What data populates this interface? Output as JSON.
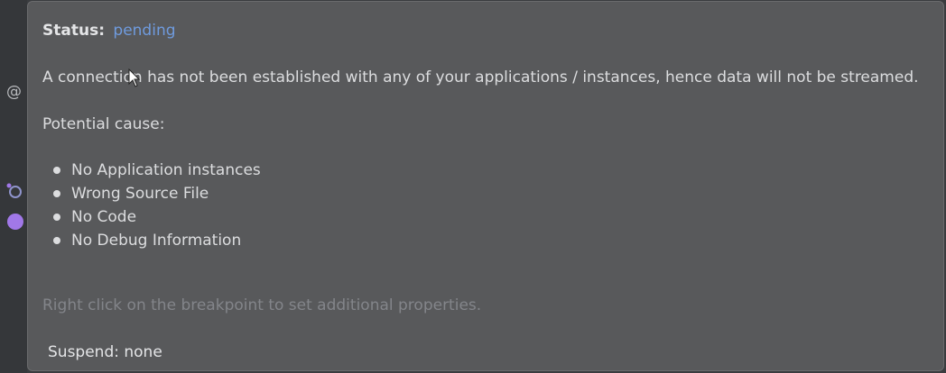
{
  "gutter": {
    "at_symbol": "@",
    "dot_color": "#a178e8"
  },
  "tooltip": {
    "status_label": "Status:",
    "status_value": "pending",
    "status_color": "#6f9bde",
    "message": "A connection has not been established with any of your applications / instances, hence data will not be streamed.",
    "cause_heading": "Potential cause:",
    "causes": [
      "No Application instances",
      "Wrong Source File",
      "No Code",
      "No Debug Information"
    ],
    "hint": "Right click on the breakpoint to set additional properties.",
    "suspend": "Suspend: none"
  },
  "icons": {
    "gutter_ring": "breakpoint-linked-icon",
    "gutter_dot": "breakpoint-dot-icon",
    "cursor": "mouse-pointer-icon"
  }
}
